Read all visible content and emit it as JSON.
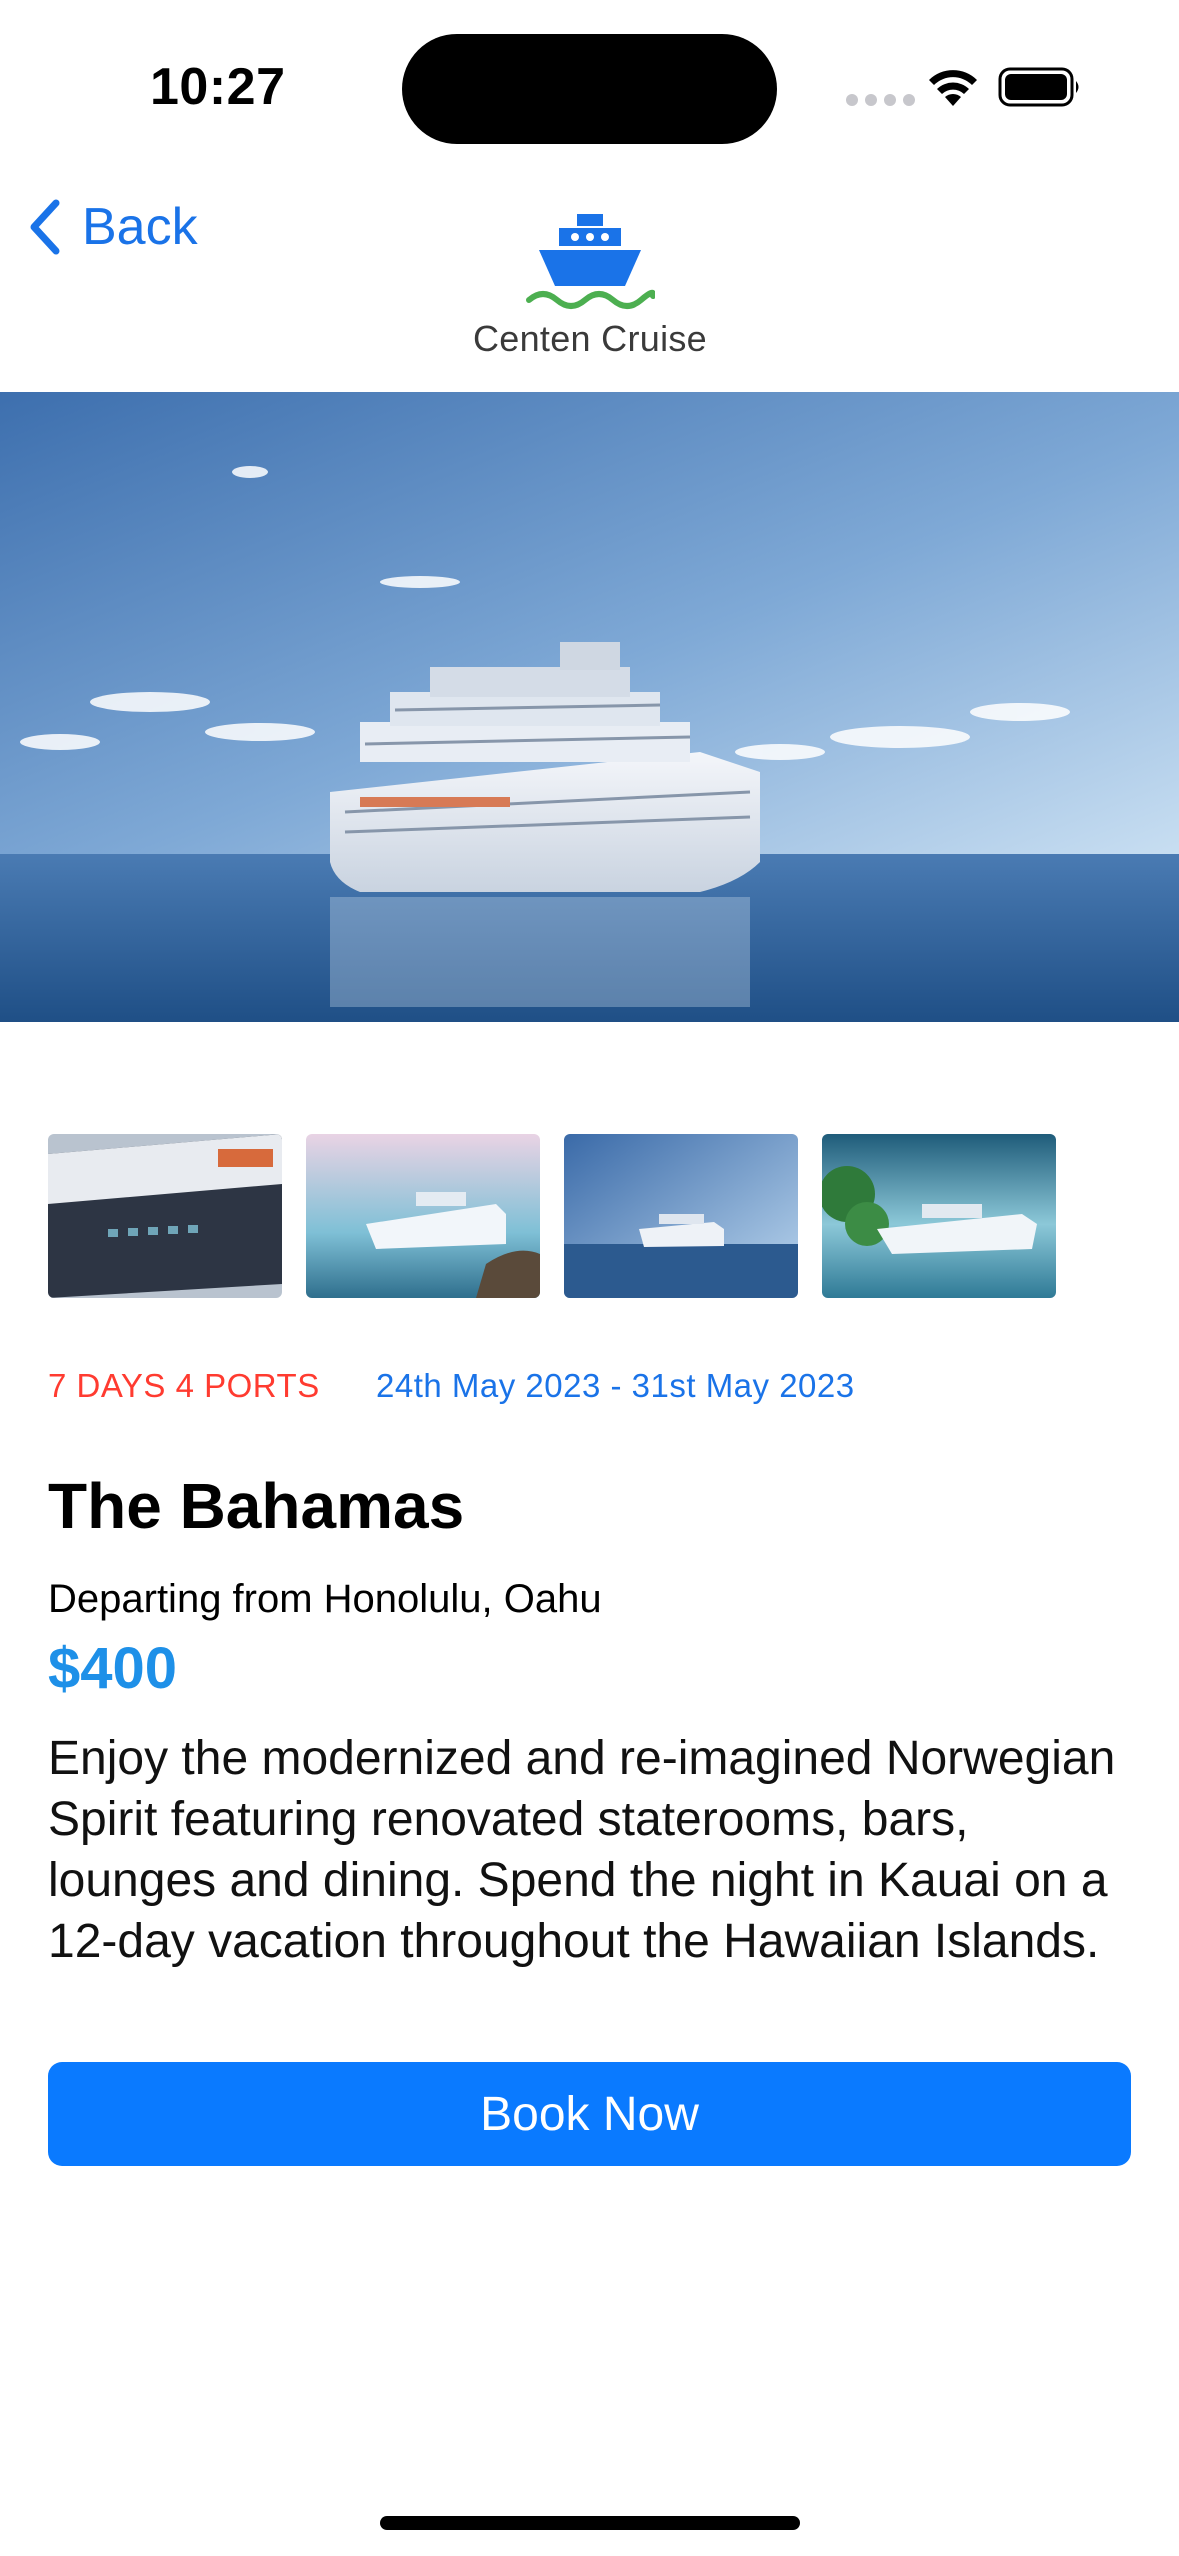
{
  "status_bar": {
    "time": "10:27"
  },
  "nav": {
    "back_label": "Back",
    "brand_name": "Centen Cruise",
    "back_icon": "chevron-left-icon",
    "logo_icon": "ship-logo-icon"
  },
  "gallery": {
    "thumbnail_count": 4
  },
  "cruise": {
    "duration": "7 DAYS 4 PORTS",
    "dates": "24th May 2023 - 31st May 2023",
    "title": "The Bahamas",
    "departure": "Departing from Honolulu, Oahu",
    "price": "$400",
    "description": "Enjoy the modernized and re-imagined Norwegian Spirit featuring renovated staterooms, bars, lounges and dining. Spend the night in Kauai on a 12-day vacation throughout the Hawaiian Islands."
  },
  "actions": {
    "book_label": "Book Now"
  },
  "colors": {
    "accent_blue": "#0a7aff",
    "link_blue": "#1a73e8",
    "price_blue": "#1e90e8",
    "duration_red": "#ff3b30"
  }
}
